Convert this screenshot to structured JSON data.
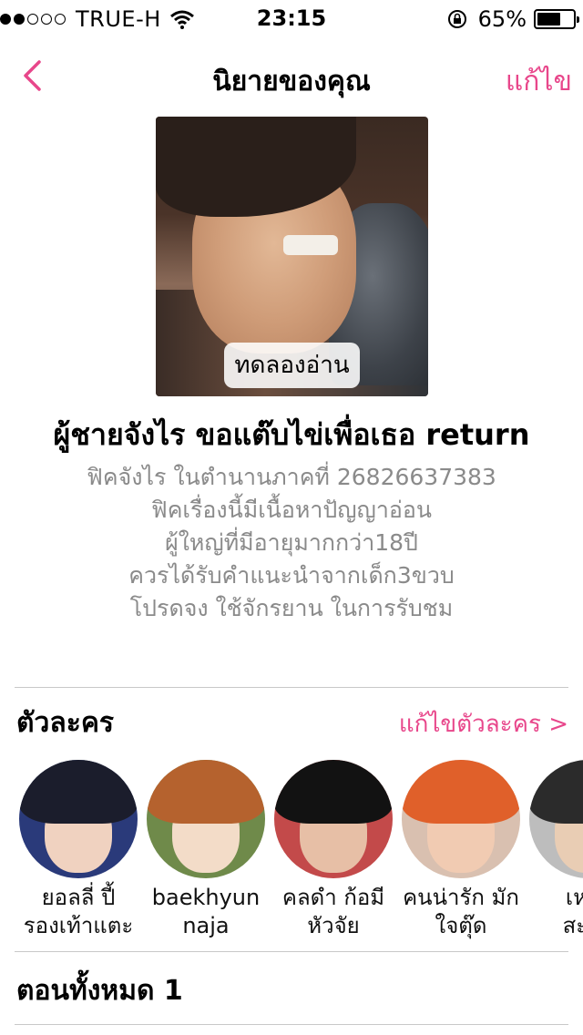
{
  "status_bar": {
    "signal_filled": 2,
    "signal_total": 5,
    "carrier": "TRUE-H",
    "time": "23:15",
    "battery_percent": 65,
    "battery_label": "65%"
  },
  "nav": {
    "title": "นิยายของคุณ",
    "edit_label": "แก้ไข"
  },
  "cover": {
    "preview_label": "ทดลองอ่าน"
  },
  "story": {
    "title": "ผู้ชายจังไร ขอแต๊บไข่เพื่อเธอ return",
    "description_lines": [
      "ฟิคจังไร ในตำนานภาคที่ 26826637383",
      "ฟิคเรื่องนี้มีเนื้อหาปัญญาอ่อน",
      "ผู้ใหญ่ที่มีอายุมากกว่า18ปี",
      "ควรได้รับคำแนะนำจากเด็ก3ขวบ",
      "โปรดจง ใช้จักรยาน ในการรับชม"
    ]
  },
  "characters": {
    "title": "ตัวละคร",
    "edit_label": "แก้ไขตัวละคร >",
    "items": [
      {
        "name_line1": "ยอลลี่ ปี้",
        "name_line2": "รองเท้าแตะ",
        "hair": "#1b1d2c",
        "skin": "#f0d2c0",
        "bg": "#2a3a7a"
      },
      {
        "name_line1": "baekhyun",
        "name_line2": "naja",
        "hair": "#b5622e",
        "skin": "#f3dcc8",
        "bg": "#6f8a4a"
      },
      {
        "name_line1": "คลดำ ก้อมี",
        "name_line2": "หัวจัย",
        "hair": "#121212",
        "skin": "#e7bfa6",
        "bg": "#c34a4a"
      },
      {
        "name_line1": "คนน่ารัก มัก",
        "name_line2": "ใจตุ๊ด",
        "hair": "#e0602a",
        "skin": "#f1cbb2",
        "bg": "#d9c0b0"
      },
      {
        "name_line1": "เหงือ",
        "name_line2": "สะท้า",
        "hair": "#2b2b2b",
        "skin": "#e9cdb4",
        "bg": "#bdbdbd"
      }
    ]
  },
  "episodes": {
    "title": "ตอนทั้งหมด 1"
  },
  "colors": {
    "accent": "#e8478b",
    "muted_text": "#8a8a8a",
    "divider": "#c8c8c8"
  }
}
